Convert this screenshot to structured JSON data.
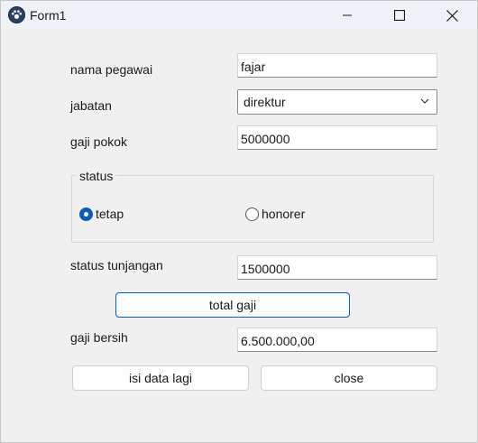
{
  "window": {
    "title": "Form1",
    "icon": "paw-icon",
    "controls": [
      "minimize-icon",
      "maximize-icon",
      "close-icon"
    ]
  },
  "form": {
    "nama_pegawai": {
      "label": "nama pegawai",
      "value": "fajar"
    },
    "jabatan": {
      "label": "jabatan",
      "value": "direktur"
    },
    "gaji_pokok": {
      "label": "gaji pokok",
      "value": "5000000"
    },
    "status": {
      "title": "status",
      "options": [
        {
          "label": "tetap",
          "checked": true
        },
        {
          "label": "honorer",
          "checked": false
        }
      ]
    },
    "status_tunjangan": {
      "label": "status tunjangan",
      "value": "1500000"
    },
    "total_button": "total gaji",
    "gaji_bersih": {
      "label": "gaji bersih",
      "value": "6.500.000,00"
    },
    "isi_button": "isi data lagi",
    "close_button": "close"
  },
  "colors": {
    "accent": "#0f5cb3",
    "window_bg": "#f0f0f0",
    "titlebar_bg": "#eef2f6"
  }
}
